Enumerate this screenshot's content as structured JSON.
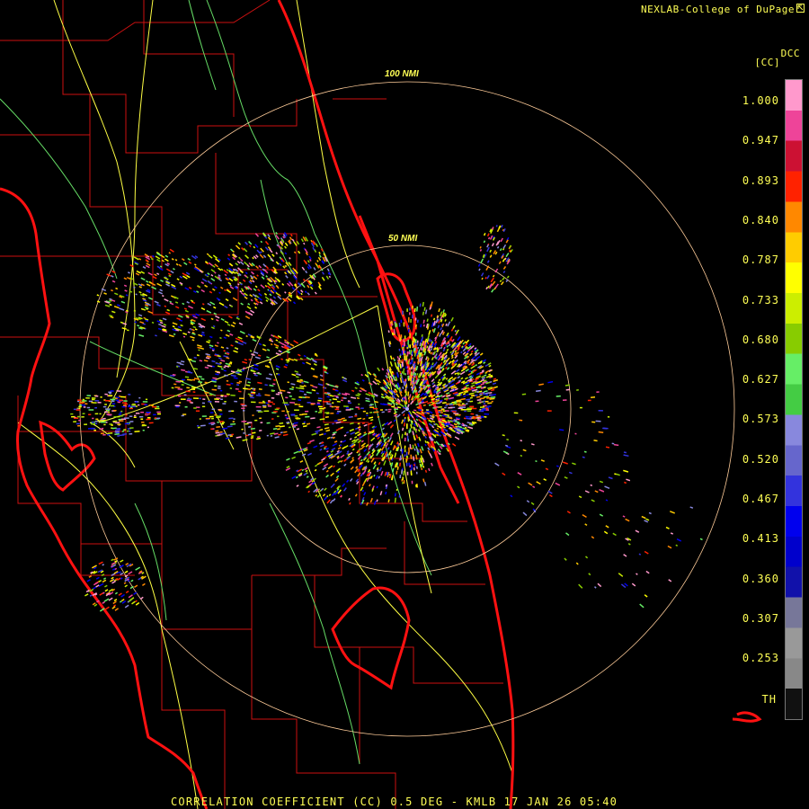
{
  "header": {
    "credit": "NEXLAB-College of DuPage",
    "credit_icon": "cursor-arrow-icon",
    "product_code": "DCC",
    "unit_label": "[CC]"
  },
  "range_rings": {
    "inner_label": "50 NMI",
    "outer_label": "100 NMI"
  },
  "legend": {
    "ticks": [
      "1.000",
      "0.947",
      "0.893",
      "0.840",
      "0.787",
      "0.733",
      "0.680",
      "0.627",
      "0.573",
      "0.520",
      "0.467",
      "0.413",
      "0.360",
      "0.307",
      "0.253"
    ],
    "threshold_label": "TH",
    "colors": [
      "#ff99cc",
      "#ee4499",
      "#cc1133",
      "#ff2200",
      "#ff8800",
      "#ffcc00",
      "#ffff00",
      "#ccee00",
      "#88cc00",
      "#66ee66",
      "#44cc44",
      "#8888dd",
      "#6666cc",
      "#3333dd",
      "#0000ee",
      "#0000cc",
      "#1111aa",
      "#777799",
      "#999999",
      "#888888",
      "#111111"
    ]
  },
  "footer": {
    "caption": "CORRELATION COEFFICIENT (CC) 0.5 DEG - KMLB 17 JAN 26 05:40"
  },
  "colors": {
    "text": "#ffff55",
    "coastline": "#ff1111",
    "county_lines": "#cc1111",
    "roads": "#ffff44",
    "rivers": "#88ff88",
    "rings": "#ffcc99"
  }
}
